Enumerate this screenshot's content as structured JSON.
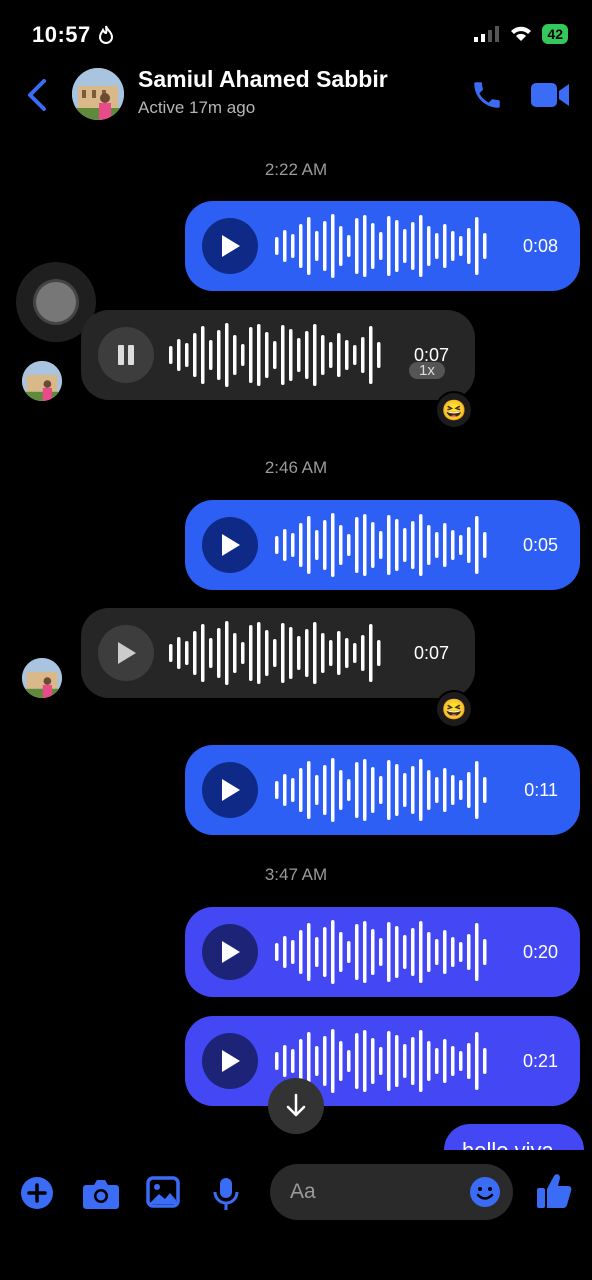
{
  "status_bar": {
    "time": "10:57",
    "battery": "42"
  },
  "header": {
    "contact_name": "Samiul Ahamed Sabbir",
    "contact_status": "Active 17m ago"
  },
  "timestamps": [
    "2:22 AM",
    "2:46 AM",
    "3:47 AM"
  ],
  "messages": [
    {
      "from": "me",
      "type": "voice",
      "duration": "0:08"
    },
    {
      "from": "them",
      "type": "voice",
      "duration": "0:07",
      "speed": "1x",
      "state": "playing",
      "reaction": "😆"
    },
    {
      "from": "me",
      "type": "voice",
      "duration": "0:05"
    },
    {
      "from": "them",
      "type": "voice",
      "duration": "0:07",
      "reaction": "😆"
    },
    {
      "from": "me",
      "type": "voice",
      "duration": "0:11"
    },
    {
      "from": "me",
      "type": "voice",
      "duration": "0:20"
    },
    {
      "from": "me",
      "type": "voice",
      "duration": "0:21"
    },
    {
      "from": "me",
      "type": "text",
      "text": "hello viva"
    }
  ],
  "composer": {
    "placeholder": "Aa"
  },
  "colors": {
    "accent": "#2e5ff5",
    "accent_violet": "#4448f4",
    "incoming_bubble": "#262626",
    "icon_blue": "#3b6cf6"
  }
}
